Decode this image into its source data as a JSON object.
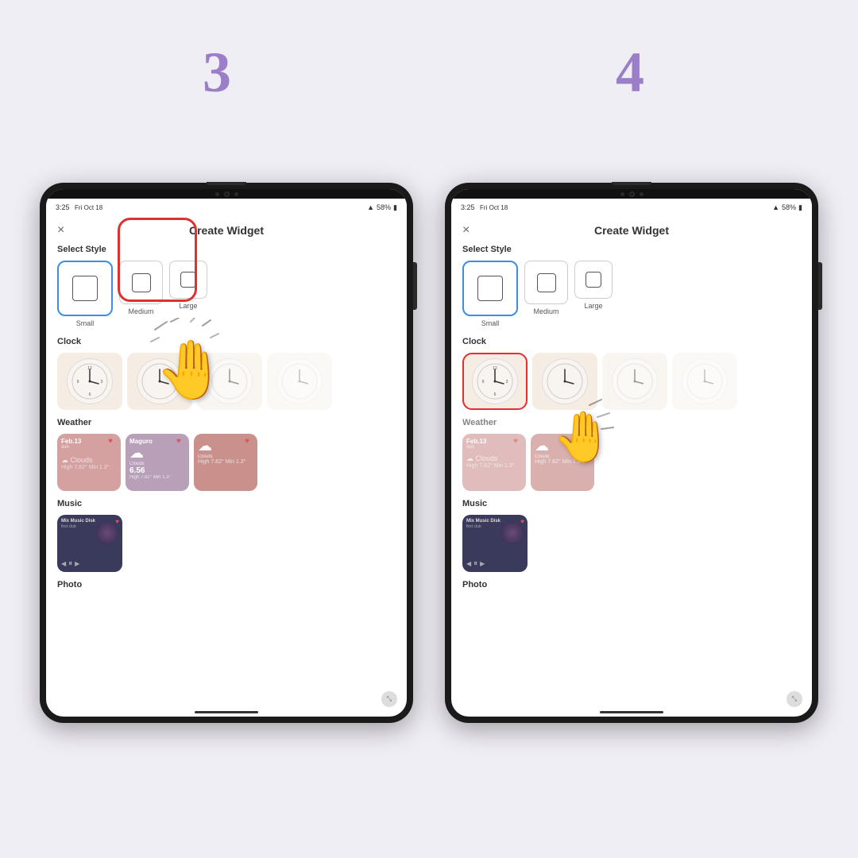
{
  "steps": {
    "left_number": "3",
    "right_number": "4"
  },
  "left_tablet": {
    "status_time": "3:25",
    "status_date": "Fri Oct 18",
    "status_signal": "58%",
    "modal_title": "Create Widget",
    "modal_close": "×",
    "select_style_label": "Select Style",
    "style_options": [
      {
        "name": "Small",
        "selected": true
      },
      {
        "name": "Medium",
        "selected": false
      },
      {
        "name": "Large",
        "selected": false
      }
    ],
    "clock_section_label": "Clock",
    "weather_section_label": "Weather",
    "music_section_label": "Music",
    "photo_section_label": "Photo",
    "weather_widgets": [
      {
        "type": "pink",
        "date": "Feb.13",
        "sub": "sun"
      },
      {
        "type": "mauve",
        "name": "Maguro",
        "temp": "6.56",
        "desc": "Clouds"
      },
      {
        "type": "rose",
        "desc": "Clouds"
      }
    ],
    "music_title": "Mix Music Disk",
    "music_artist": "first club"
  },
  "right_tablet": {
    "status_time": "3:25",
    "status_date": "Fri Oct 18",
    "status_signal": "58%",
    "modal_title": "Create Widget",
    "modal_close": "×",
    "select_style_label": "Select Style",
    "clock_section_label": "Clock",
    "weather_section_label": "Weather",
    "music_section_label": "Music",
    "photo_section_label": "Photo",
    "weather_widgets": [
      {
        "type": "pink",
        "date": "Feb.13",
        "sub": "sun"
      },
      {
        "type": "rose",
        "desc": "Clouds"
      }
    ],
    "music_title": "Mix Music Disk",
    "music_artist": "first club"
  },
  "icons": {
    "close": "×",
    "heart": "♥",
    "cloud": "☁",
    "prev": "◀",
    "play": "▶",
    "pause": "⏸",
    "next": "▶▶",
    "expand": "⤡"
  }
}
